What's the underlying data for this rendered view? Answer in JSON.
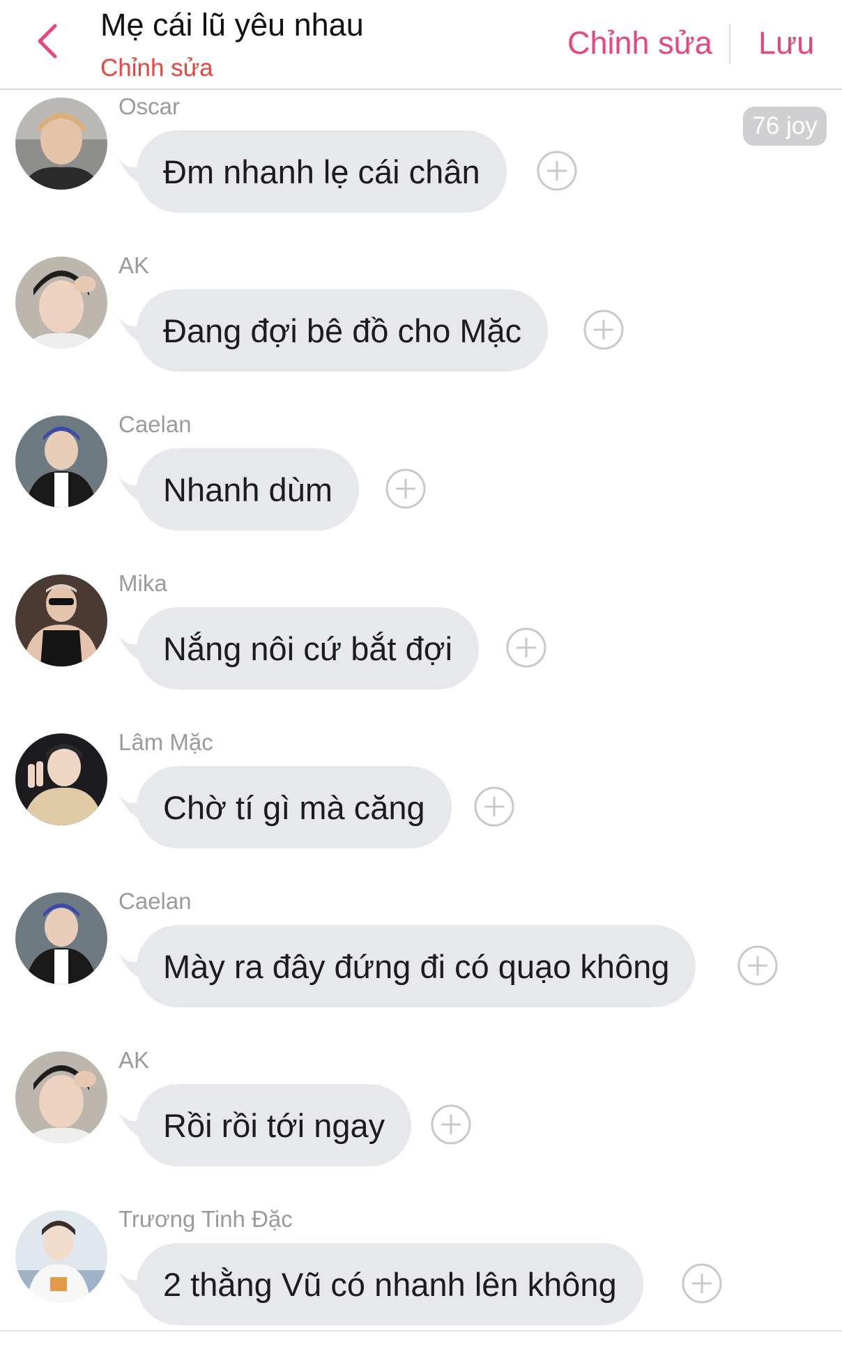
{
  "header": {
    "title": "Mẹ cái lũ yêu nhau",
    "subtitle": "Chỉnh sửa",
    "edit_label": "Chỉnh sửa",
    "save_label": "Lưu",
    "back_icon": "chevron-left-icon",
    "accent_color": "#e8457c"
  },
  "joy_badge": "76 joy",
  "messages": [
    {
      "sender": "Oscar",
      "text": "Đm nhanh lẹ cái chân"
    },
    {
      "sender": "AK",
      "text": "Đang đợi bê đồ cho Mặc"
    },
    {
      "sender": "Caelan",
      "text": "Nhanh dùm"
    },
    {
      "sender": "Mika",
      "text": "Nắng nôi cứ bắt đợi"
    },
    {
      "sender": "Lâm Mặc",
      "text": "Chờ tí gì mà căng"
    },
    {
      "sender": "Caelan",
      "text": "Mày ra đây đứng đi có quạo không"
    },
    {
      "sender": "AK",
      "text": "Rồi rồi tới ngay"
    },
    {
      "sender": "Trương Tinh Đặc",
      "text": "2 thằng Vũ có nhanh lên không"
    }
  ],
  "colors": {
    "bubble": "#e6e8ec",
    "sender_name": "#9a9a9e",
    "subtitle": "#e8453c",
    "badge": "#cfcfd1"
  }
}
